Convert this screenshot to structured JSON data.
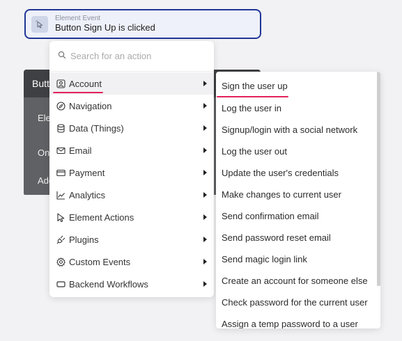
{
  "event": {
    "type_label": "Element Event",
    "name": "Button Sign Up is clicked"
  },
  "background_panel": {
    "title": "Butt",
    "rows": [
      "Ele",
      "On",
      "Add"
    ]
  },
  "search": {
    "placeholder": "Search for an action"
  },
  "menu": {
    "items": [
      {
        "label": "Account",
        "icon": "user-icon"
      },
      {
        "label": "Navigation",
        "icon": "compass-icon"
      },
      {
        "label": "Data (Things)",
        "icon": "database-icon"
      },
      {
        "label": "Email",
        "icon": "mail-icon"
      },
      {
        "label": "Payment",
        "icon": "credit-card-icon"
      },
      {
        "label": "Analytics",
        "icon": "chart-line-icon"
      },
      {
        "label": "Element Actions",
        "icon": "pointer-icon"
      },
      {
        "label": "Plugins",
        "icon": "plug-icon"
      },
      {
        "label": "Custom Events",
        "icon": "gear-icon"
      },
      {
        "label": "Backend Workflows",
        "icon": "server-icon"
      }
    ],
    "active": "Account"
  },
  "submenu": {
    "items": [
      "Sign the user up",
      "Log the user in",
      "Signup/login with a social network",
      "Log the user out",
      "Update the user's credentials",
      "Make changes to current user",
      "Send confirmation email",
      "Send password reset email",
      "Send magic login link",
      "Create an account for someone else",
      "Check password for the current user",
      "Assign a temp password to a user"
    ]
  },
  "colors": {
    "header_border": "#1f3596",
    "highlight_underline": "#e3225b",
    "panel_dark": "#5f6164"
  }
}
